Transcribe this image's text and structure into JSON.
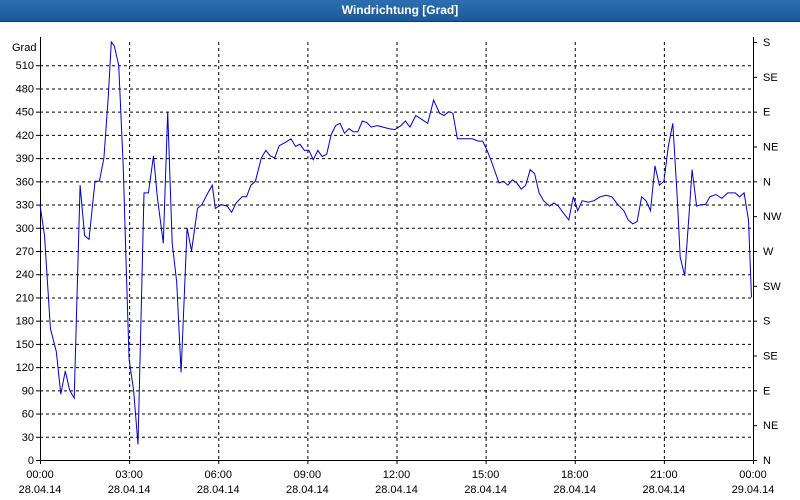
{
  "window": {
    "title": "Windrichtung [Grad]"
  },
  "chart_data": {
    "type": "line",
    "title": "Windrichtung [Grad]",
    "ylabel": "Grad",
    "ylim": [
      0,
      540
    ],
    "xlim_hours": [
      0,
      24
    ],
    "grid": true,
    "y_ticks": [
      0,
      30,
      60,
      90,
      120,
      150,
      180,
      210,
      240,
      270,
      300,
      330,
      360,
      390,
      420,
      450,
      480,
      510
    ],
    "right_ticks": [
      {
        "y": 0,
        "label": "N"
      },
      {
        "y": 45,
        "label": "NE"
      },
      {
        "y": 90,
        "label": "E"
      },
      {
        "y": 135,
        "label": "SE"
      },
      {
        "y": 180,
        "label": "S"
      },
      {
        "y": 225,
        "label": "SW"
      },
      {
        "y": 270,
        "label": "W"
      },
      {
        "y": 315,
        "label": "NW"
      },
      {
        "y": 360,
        "label": "N"
      },
      {
        "y": 405,
        "label": "NE"
      },
      {
        "y": 450,
        "label": "E"
      },
      {
        "y": 495,
        "label": "SE"
      },
      {
        "y": 540,
        "label": "S"
      }
    ],
    "x_ticks": [
      {
        "x": 0,
        "time": "00:00",
        "date": "28.04.14"
      },
      {
        "x": 3,
        "time": "03:00",
        "date": "28.04.14"
      },
      {
        "x": 6,
        "time": "06:00",
        "date": "28.04.14"
      },
      {
        "x": 9,
        "time": "09:00",
        "date": "28.04.14"
      },
      {
        "x": 12,
        "time": "12:00",
        "date": "28.04.14"
      },
      {
        "x": 15,
        "time": "15:00",
        "date": "28.04.14"
      },
      {
        "x": 18,
        "time": "18:00",
        "date": "28.04.14"
      },
      {
        "x": 21,
        "time": "21:00",
        "date": "28.04.14"
      },
      {
        "x": 24,
        "time": "00:00",
        "date": "29.04.14"
      }
    ],
    "colors": {
      "line": "#0000cc",
      "grid": "#000000",
      "axis": "#000000",
      "title_bar": "#1f5f9f"
    },
    "series": [
      {
        "points": [
          [
            0.0,
            330
          ],
          [
            0.15,
            290
          ],
          [
            0.35,
            170
          ],
          [
            0.55,
            140
          ],
          [
            0.7,
            85
          ],
          [
            0.85,
            115
          ],
          [
            1.0,
            90
          ],
          [
            1.15,
            80
          ],
          [
            1.35,
            355
          ],
          [
            1.5,
            290
          ],
          [
            1.65,
            285
          ],
          [
            1.85,
            360
          ],
          [
            2.0,
            360
          ],
          [
            2.15,
            390
          ],
          [
            2.3,
            470
          ],
          [
            2.4,
            540
          ],
          [
            2.5,
            535
          ],
          [
            2.65,
            510
          ],
          [
            2.8,
            380
          ],
          [
            2.9,
            250
          ],
          [
            3.0,
            130
          ],
          [
            3.15,
            90
          ],
          [
            3.3,
            20
          ],
          [
            3.5,
            345
          ],
          [
            3.65,
            345
          ],
          [
            3.82,
            393
          ],
          [
            3.95,
            340
          ],
          [
            4.15,
            280
          ],
          [
            4.3,
            450
          ],
          [
            4.45,
            280
          ],
          [
            4.6,
            230
          ],
          [
            4.75,
            113
          ],
          [
            4.95,
            300
          ],
          [
            5.1,
            270
          ],
          [
            5.3,
            325
          ],
          [
            5.45,
            330
          ],
          [
            5.65,
            345
          ],
          [
            5.8,
            355
          ],
          [
            5.9,
            325
          ],
          [
            6.1,
            330
          ],
          [
            6.3,
            328
          ],
          [
            6.45,
            320
          ],
          [
            6.6,
            332
          ],
          [
            6.8,
            340
          ],
          [
            6.95,
            340
          ],
          [
            7.1,
            355
          ],
          [
            7.25,
            360
          ],
          [
            7.45,
            390
          ],
          [
            7.6,
            400
          ],
          [
            7.75,
            393
          ],
          [
            7.9,
            390
          ],
          [
            8.05,
            406
          ],
          [
            8.25,
            410
          ],
          [
            8.45,
            415
          ],
          [
            8.6,
            405
          ],
          [
            8.75,
            408
          ],
          [
            8.9,
            400
          ],
          [
            9.05,
            400
          ],
          [
            9.2,
            388
          ],
          [
            9.35,
            400
          ],
          [
            9.5,
            392
          ],
          [
            9.65,
            395
          ],
          [
            9.8,
            420
          ],
          [
            9.95,
            432
          ],
          [
            10.1,
            435
          ],
          [
            10.25,
            422
          ],
          [
            10.4,
            428
          ],
          [
            10.55,
            424
          ],
          [
            10.7,
            424
          ],
          [
            10.85,
            438
          ],
          [
            11.0,
            436
          ],
          [
            11.15,
            430
          ],
          [
            11.35,
            432
          ],
          [
            11.55,
            430
          ],
          [
            11.75,
            428
          ],
          [
            11.95,
            427
          ],
          [
            12.15,
            432
          ],
          [
            12.3,
            438
          ],
          [
            12.45,
            430
          ],
          [
            12.65,
            445
          ],
          [
            12.85,
            440
          ],
          [
            13.05,
            435
          ],
          [
            13.25,
            465
          ],
          [
            13.45,
            448
          ],
          [
            13.6,
            445
          ],
          [
            13.75,
            450
          ],
          [
            13.9,
            448
          ],
          [
            14.05,
            415
          ],
          [
            14.3,
            415
          ],
          [
            14.55,
            415
          ],
          [
            14.75,
            412
          ],
          [
            14.9,
            412
          ],
          [
            15.05,
            400
          ],
          [
            15.2,
            385
          ],
          [
            15.45,
            358
          ],
          [
            15.6,
            360
          ],
          [
            15.75,
            355
          ],
          [
            15.9,
            362
          ],
          [
            16.05,
            358
          ],
          [
            16.2,
            350
          ],
          [
            16.35,
            355
          ],
          [
            16.5,
            375
          ],
          [
            16.65,
            370
          ],
          [
            16.8,
            345
          ],
          [
            16.95,
            335
          ],
          [
            17.15,
            328
          ],
          [
            17.3,
            332
          ],
          [
            17.45,
            328
          ],
          [
            17.6,
            320
          ],
          [
            17.8,
            310
          ],
          [
            17.95,
            340
          ],
          [
            18.1,
            322
          ],
          [
            18.25,
            335
          ],
          [
            18.45,
            333
          ],
          [
            18.65,
            335
          ],
          [
            18.85,
            340
          ],
          [
            19.05,
            342
          ],
          [
            19.25,
            340
          ],
          [
            19.45,
            330
          ],
          [
            19.65,
            322
          ],
          [
            19.8,
            310
          ],
          [
            19.95,
            305
          ],
          [
            20.1,
            308
          ],
          [
            20.25,
            340
          ],
          [
            20.4,
            335
          ],
          [
            20.55,
            322
          ],
          [
            20.7,
            380
          ],
          [
            20.85,
            355
          ],
          [
            21.0,
            360
          ],
          [
            21.15,
            405
          ],
          [
            21.3,
            435
          ],
          [
            21.45,
            340
          ],
          [
            21.55,
            262
          ],
          [
            21.7,
            238
          ],
          [
            21.85,
            318
          ],
          [
            21.95,
            375
          ],
          [
            22.1,
            328
          ],
          [
            22.25,
            330
          ],
          [
            22.4,
            330
          ],
          [
            22.55,
            340
          ],
          [
            22.75,
            343
          ],
          [
            22.95,
            338
          ],
          [
            23.15,
            345
          ],
          [
            23.4,
            345
          ],
          [
            23.55,
            340
          ],
          [
            23.7,
            345
          ],
          [
            23.85,
            310
          ],
          [
            23.95,
            210
          ]
        ]
      }
    ]
  }
}
